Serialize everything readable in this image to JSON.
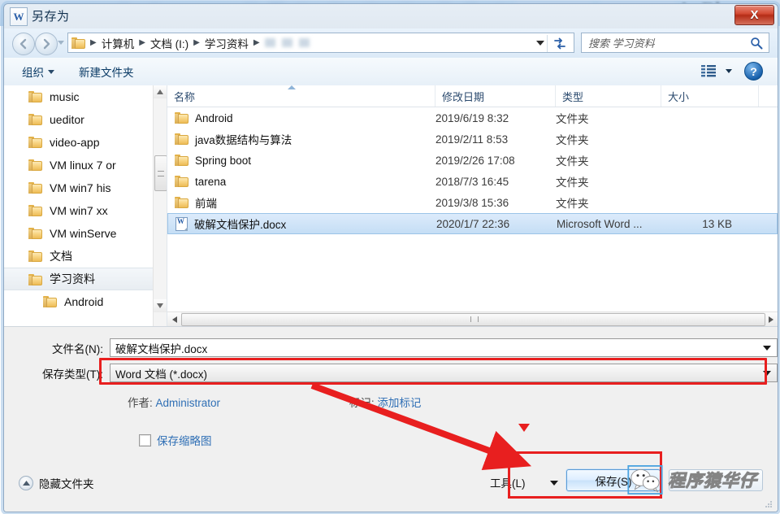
{
  "window": {
    "title": "另存为",
    "app_icon": "word-icon",
    "app_icon_letter": "W",
    "close_label": "X"
  },
  "address_bar": {
    "breadcrumbs": [
      "计算机",
      "文档 (I:)",
      "学习资料"
    ],
    "separator": "▸",
    "back_icon": "back-arrow-icon",
    "forward_icon": "forward-arrow-icon",
    "refresh_icon": "refresh-icon",
    "dropdown_icon": "chevron-down-icon"
  },
  "search": {
    "placeholder": "搜索 学习资料",
    "icon": "search-icon"
  },
  "toolbar": {
    "organize": "组织",
    "new_folder": "新建文件夹",
    "view_icon": "view-mode-icon",
    "help_label": "?"
  },
  "tree": {
    "items": [
      {
        "label": "music",
        "indented": false,
        "selected": false
      },
      {
        "label": "ueditor",
        "indented": false,
        "selected": false
      },
      {
        "label": "video-app",
        "indented": false,
        "selected": false
      },
      {
        "label": "VM linux 7 or",
        "indented": false,
        "selected": false
      },
      {
        "label": "VM win7 his",
        "indented": false,
        "selected": false
      },
      {
        "label": "VM win7 xx",
        "indented": false,
        "selected": false
      },
      {
        "label": "VM winServe",
        "indented": false,
        "selected": false
      },
      {
        "label": "文档",
        "indented": false,
        "selected": false
      },
      {
        "label": "学习资料",
        "indented": false,
        "selected": true
      },
      {
        "label": "Android",
        "indented": true,
        "selected": false
      }
    ]
  },
  "file_list": {
    "columns": [
      "名称",
      "修改日期",
      "类型",
      "大小"
    ],
    "rows": [
      {
        "name": "Android",
        "date": "2019/6/19 8:32",
        "type": "文件夹",
        "size": "",
        "icon": "folder-icon",
        "selected": false
      },
      {
        "name": "java数据结构与算法",
        "date": "2019/2/11 8:53",
        "type": "文件夹",
        "size": "",
        "icon": "folder-icon",
        "selected": false
      },
      {
        "name": "Spring boot",
        "date": "2019/2/26 17:08",
        "type": "文件夹",
        "size": "",
        "icon": "folder-icon",
        "selected": false
      },
      {
        "name": "tarena",
        "date": "2018/7/3 16:45",
        "type": "文件夹",
        "size": "",
        "icon": "folder-icon",
        "selected": false
      },
      {
        "name": "前端",
        "date": "2019/3/8 15:36",
        "type": "文件夹",
        "size": "",
        "icon": "folder-icon",
        "selected": false
      },
      {
        "name": "破解文档保护.docx",
        "date": "2020/1/7 22:36",
        "type": "Microsoft Word ...",
        "size": "13 KB",
        "icon": "word-doc-icon",
        "selected": true
      }
    ]
  },
  "form": {
    "filename_label": "文件名(N):",
    "filename_value": "破解文档保护.docx",
    "savetype_label": "保存类型(T):",
    "savetype_value": "Word 文档 (*.docx)",
    "author_key": "作者:",
    "author_value": "Administrator",
    "tags_key": "标记:",
    "tags_value": "添加标记",
    "thumbnail_label": "保存缩略图",
    "thumbnail_checked": false,
    "hide_folders_label": "隐藏文件夹",
    "hide_folders_icon": "chevron-up-circle-icon",
    "tools_label": "工具(L)",
    "save_label": "保存(S)"
  },
  "annotations": {
    "accent_color": "#e81f1f",
    "rect_savetype": "highlight-save-type-row",
    "rect_savebutton": "highlight-save-button",
    "arrow": "red-arrow-pointing-to-save"
  },
  "watermark": {
    "text": "程序猿华仔",
    "logo": "wechat-logo"
  }
}
